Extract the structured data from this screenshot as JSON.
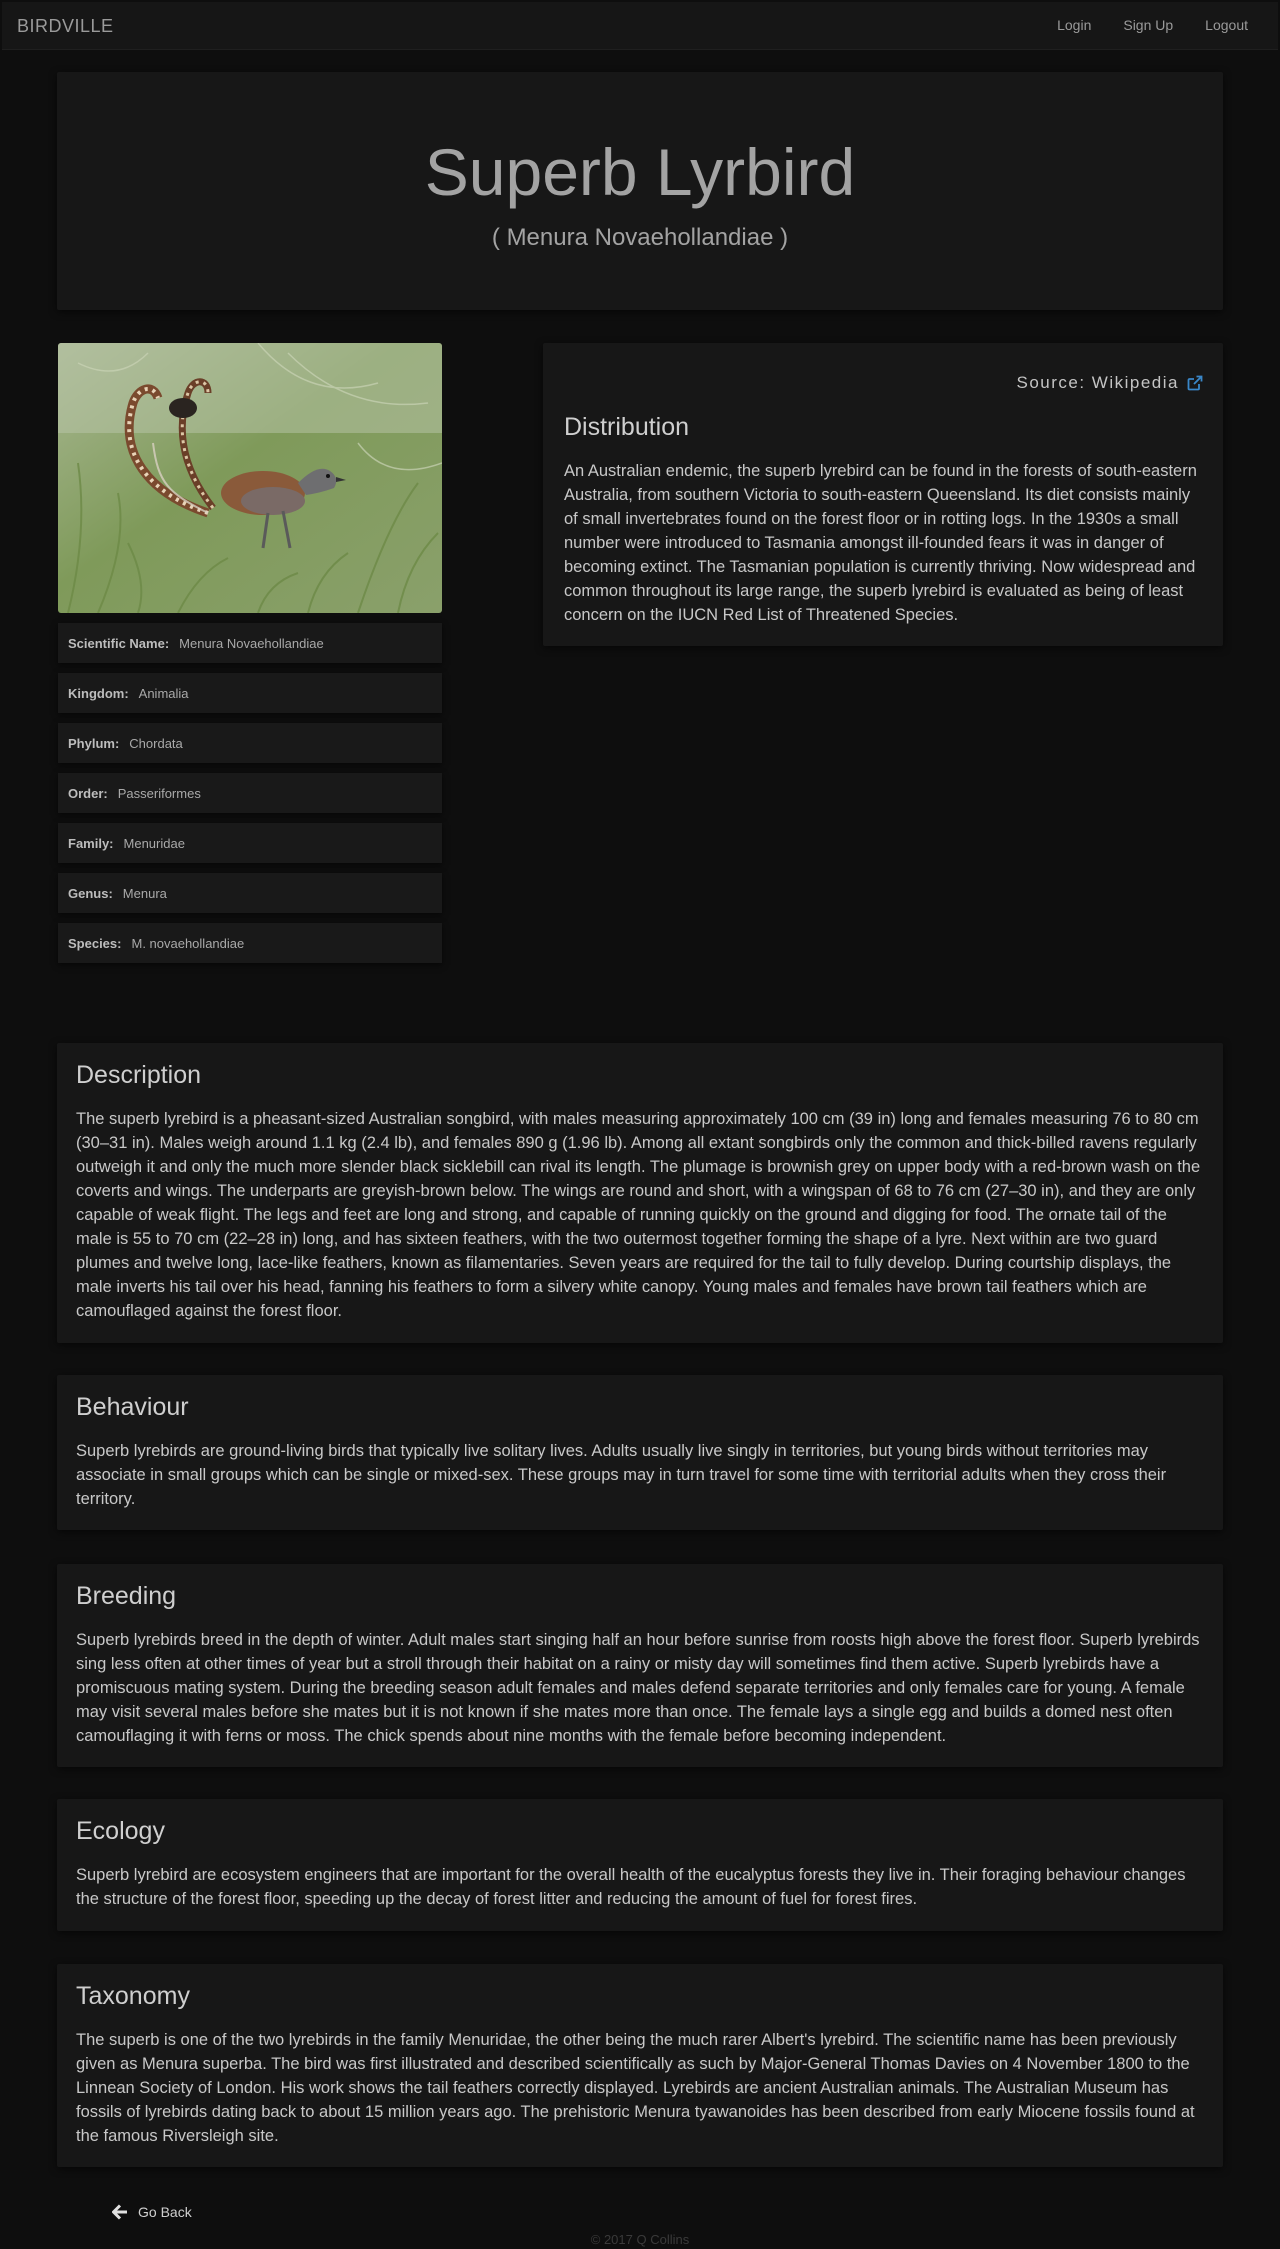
{
  "nav": {
    "brand": "BIRDVILLE",
    "links": [
      "Login",
      "Sign Up",
      "Logout"
    ]
  },
  "hero": {
    "title": "Superb Lyrbird",
    "subtitle": "( Menura Novaehollandiae )"
  },
  "image": {
    "alt": "Superb lyrebird photo"
  },
  "taxonomy_list": [
    {
      "label": "Scientific Name:",
      "value": "Menura Novaehollandiae"
    },
    {
      "label": "Kingdom:",
      "value": "Animalia"
    },
    {
      "label": "Phylum:",
      "value": "Chordata"
    },
    {
      "label": "Order:",
      "value": "Passeriformes"
    },
    {
      "label": "Family:",
      "value": "Menuridae"
    },
    {
      "label": "Genus:",
      "value": "Menura"
    },
    {
      "label": "Species:",
      "value": "M. novaehollandiae"
    }
  ],
  "source": {
    "label": "Source: Wikipedia"
  },
  "sections": {
    "distribution": {
      "title": "Distribution",
      "text": "An Australian endemic, the superb lyrebird can be found in the forests of south-eastern Australia, from southern Victoria to south-eastern Queensland. Its diet consists mainly of small invertebrates found on the forest floor or in rotting logs. In the 1930s a small number were introduced to Tasmania amongst ill-founded fears it was in danger of becoming extinct. The Tasmanian population is currently thriving. Now widespread and common throughout its large range, the superb lyrebird is evaluated as being of least concern on the IUCN Red List of Threatened Species."
    },
    "description": {
      "title": "Description",
      "text": "The superb lyrebird is a pheasant-sized Australian songbird, with males measuring approximately 100 cm (39 in) long and females measuring 76 to 80 cm (30–31 in). Males weigh around 1.1 kg (2.4 lb), and females 890 g (1.96 lb). Among all extant songbirds only the common and thick-billed ravens regularly outweigh it and only the much more slender black sicklebill can rival its length. The plumage is brownish grey on upper body with a red-brown wash on the coverts and wings. The underparts are greyish-brown below. The wings are round and short, with a wingspan of 68 to 76 cm (27–30 in), and they are only capable of weak flight. The legs and feet are long and strong, and capable of running quickly on the ground and digging for food. The ornate tail of the male is 55 to 70 cm (22–28 in) long, and has sixteen feathers, with the two outermost together forming the shape of a lyre. Next within are two guard plumes and twelve long, lace-like feathers, known as filamentaries. Seven years are required for the tail to fully develop. During courtship displays, the male inverts his tail over his head, fanning his feathers to form a silvery white canopy. Young males and females have brown tail feathers which are camouflaged against the forest floor."
    },
    "behaviour": {
      "title": "Behaviour",
      "text": "Superb lyrebirds are ground-living birds that typically live solitary lives. Adults usually live singly in territories, but young birds without territories may associate in small groups which can be single or mixed-sex. These groups may in turn travel for some time with territorial adults when they cross their territory."
    },
    "breeding": {
      "title": "Breeding",
      "text": "Superb lyrebirds breed in the depth of winter. Adult males start singing half an hour before sunrise from roosts high above the forest floor. Superb lyrebirds sing less often at other times of year but a stroll through their habitat on a rainy or misty day will sometimes find them active. Superb lyrebirds have a promiscuous mating system. During the breeding season adult females and males defend separate territories and only females care for young. A female may visit several males before she mates but it is not known if she mates more than once. The female lays a single egg and builds a domed nest often camouflaging it with ferns or moss. The chick spends about nine months with the female before becoming independent."
    },
    "ecology": {
      "title": "Ecology",
      "text": "Superb lyrebird are ecosystem engineers that are important for the overall health of the eucalyptus forests they live in. Their foraging behaviour changes the structure of the forest floor, speeding up the decay of forest litter and reducing the amount of fuel for forest fires."
    },
    "taxonomy": {
      "title": "Taxonomy",
      "text": "The superb is one of the two lyrebirds in the family Menuridae, the other being the much rarer Albert's lyrebird. The scientific name has been previously given as Menura superba. The bird was first illustrated and described scientifically as such by Major-General Thomas Davies on 4 November 1800 to the Linnean Society of London. His work shows the tail feathers correctly displayed. Lyrebirds are ancient Australian animals. The Australian Museum has fossils of lyrebirds dating back to about 15 million years ago. The prehistoric Menura tyawanoides has been described from early Miocene fossils found at the famous Riversleigh site."
    }
  },
  "go_back": "Go Back",
  "footer": "© 2017 Q Collins",
  "colors": {
    "background": "#0e0e0e",
    "panel": "#171717",
    "link_icon": "#3a87c8"
  },
  "icons": {
    "external_link": "external-link-icon",
    "back": "arrow-left-icon"
  }
}
